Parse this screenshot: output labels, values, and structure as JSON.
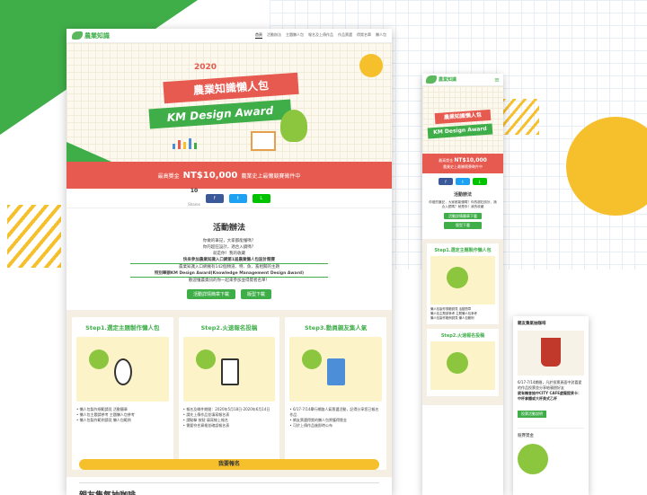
{
  "site": {
    "logo_text": "農業知識",
    "nav": [
      "首頁",
      "活動辦法",
      "主題懶人包",
      "報名及上傳作品",
      "作品票選",
      "得獎名單",
      "懶人包"
    ],
    "mobile_menu_icon": "menu-icon"
  },
  "hero": {
    "year": "2020",
    "title_cn": "農業知識懶人包",
    "title_en": "KM Design Award"
  },
  "prize": {
    "label": "最高獎金",
    "amount": "NT$10,000",
    "tail": "農業史上最懶競賽徵件中"
  },
  "share": {
    "count": "10",
    "count_label": "Shares",
    "buttons": [
      {
        "label": "f",
        "color": "#3b5998"
      },
      {
        "label": "t",
        "color": "#1da1f2"
      },
      {
        "label": "L",
        "color": "#00c300"
      }
    ]
  },
  "intro": {
    "title": "活動辦法",
    "lines": [
      "你做的筆記，大家都能懂嗎？",
      "你的超狂設計，適合入鏡嗎？",
      "就是你！我的收藏",
      "快來參加農業知識入口網第1屆農業懶人包設計競賽",
      "農業知識入口網擁有142個頻道、特、魚、畜相關的主題",
      "特別舉辦KM Design Award(Knowledge Management Design Award)",
      "歡迎懂農資訊的你一起來參加並得獎者名單！"
    ],
    "btn_download": "活動詳情簡章下載",
    "btn_form": "版型下載"
  },
  "steps": [
    {
      "title": "Step1.選定主題製作懶人包",
      "bullets": [
        "懶人包製作規範請見 活動簡章",
        "懶人包主題請參考 主題懶人包參考",
        "懶人包製作範例請見 懶人包範例"
      ]
    },
    {
      "title": "Step2.火速報名投稿",
      "bullets": [
        "報名及徵件期間：2020年5月18日-2020年6月14日",
        "請先上傳作品並填寫報名表",
        "請點擊 按鈕 填寫線上報名",
        "需要符合資格並確認報名表"
      ]
    },
    {
      "title": "Step3.動員親友集人氣",
      "bullets": [
        "6/17-7/14舉行網路人氣票選活動，記得分享您已報名作品",
        "網友票選得獎的懶人包將獲得獎金",
        "可於上傳作品後即時公布"
      ]
    }
  ],
  "cta": "我要報名",
  "next_section": "親友集氣抽咖啡",
  "mobile": {
    "prize_label": "最高獎金",
    "prize_amount": "NT$10,000",
    "prize_tail": "農業史上最懶競賽徵件中",
    "section_title": "活動辦法",
    "body": "你做的筆記，大家都能懂嗎？你的超狂設計，適合入鏡嗎？就是你！我的收藏",
    "btn_download": "活動詳情簡章下載",
    "btn_form": "版型下載",
    "step1": "Step1.選定主題製作懶人包",
    "step2": "Step2.火速報名投稿",
    "step1_bullets": [
      "懶人包製作規範請見 活動簡章",
      "懶人包主題請參考 主題懶人包參考",
      "懶人包製作範例請見 懶人包範例"
    ]
  },
  "card": {
    "title": "親友集氣抽咖啡",
    "desc": "6/17-7/14期間，凡於投票頁面中對喜愛的作品投票並分享給親朋好友",
    "extra": "就有機會抽中CITY CAFE虛擬提貨卡：中杯拿鐵或大杯美式乙杯",
    "button": "投票活動說明",
    "sub_title": "競賽獎金"
  },
  "colors": {
    "green": "#3fae49",
    "red": "#e65a50",
    "yellow": "#f6c02d"
  }
}
